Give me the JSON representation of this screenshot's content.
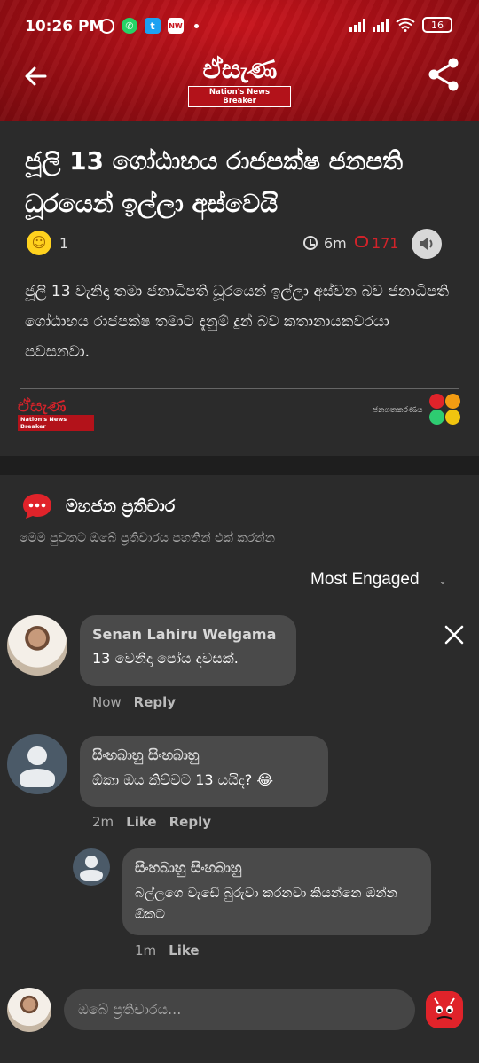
{
  "status_bar": {
    "time": "10:26 PM",
    "battery": "16"
  },
  "header": {
    "logo_text": "ඒසැණ",
    "logo_tagline": "Nation's News Breaker"
  },
  "article": {
    "title": "ජූලි 13 ගෝඨාභය රාජපක්ෂ ජනපති ධූරයෙන් ඉල්ලා අස්වෙයි",
    "reaction_count": "1",
    "time_ago": "6m",
    "comment_count": "171",
    "body": "ජූලි 13 වැනිදා තමා ජනාධිපති ධූරයෙන් ඉල්ලා අස්වන බව ජනාධිපති ගෝඨාභය රාජපක්ෂ තමාට දැනුම් දුන් බව කතානායකවරයා පවසනවා.",
    "footer_logo": "ඒසැණ",
    "footer_tagline": "Nation's News Breaker",
    "footer_right": "ජනගතකරණය"
  },
  "comments_section": {
    "title": "මහජන ප්‍රතිචාර",
    "subtitle": "මෙම පුවතට ඔබේ ප්‍රතිචාරය පහතින් එක් කරන්න",
    "sort_label": "Most Engaged",
    "comments": [
      {
        "name": "Senan Lahiru Welgama",
        "text": "13 වෙනිදා පෝය දවසක්.",
        "time": "Now",
        "reply": "Reply"
      },
      {
        "name": "සිංහබාහු සිංහබාහු",
        "text": "ඕකා ඔය කිව්වට 13 යයිද? 😂",
        "time": "2m",
        "like": "Like",
        "reply": "Reply"
      }
    ],
    "reply": {
      "name": "සිංහබාහු සිංහබාහු",
      "text": "බල්ලගෙ වැඩේ බුරුවා කරනවා කියන්නෙ ඔන්න ඕකට",
      "time": "1m",
      "like": "Like"
    },
    "input_placeholder": "ඔබේ ප්‍රතිචාරය..."
  }
}
